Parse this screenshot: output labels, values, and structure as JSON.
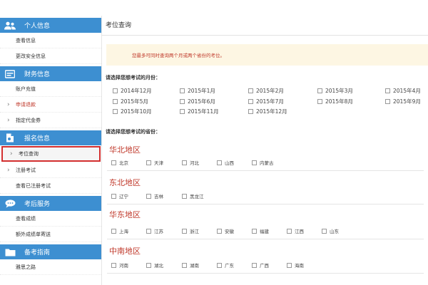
{
  "sidebar": {
    "sections": [
      {
        "title": "个人信息",
        "icon": "users-icon",
        "items": [
          {
            "label": "查看信息"
          },
          {
            "label": "更改安全信息"
          }
        ]
      },
      {
        "title": "财务信息",
        "icon": "finance-icon",
        "items": [
          {
            "label": "账户充值"
          },
          {
            "label": "申请退款"
          },
          {
            "label": "指定代金券"
          }
        ]
      },
      {
        "title": "报名信息",
        "icon": "document-icon",
        "items": [
          {
            "label": "考位查询"
          },
          {
            "label": "注册考试"
          },
          {
            "label": "查看已注册考试"
          }
        ]
      },
      {
        "title": "考后服务",
        "icon": "chat-icon",
        "items": [
          {
            "label": "查看成绩"
          },
          {
            "label": "额外成绩单寄送"
          }
        ]
      },
      {
        "title": "备考指南",
        "icon": "folder-icon",
        "items": [
          {
            "label": "雅思之路"
          }
        ]
      }
    ]
  },
  "main": {
    "title": "考位查询",
    "notice": "您最多可同时查询两个月或两个省份的考位。",
    "month_label": "请选择您想考试的月份：",
    "months": [
      "2014年12月",
      "2015年1月",
      "2015年2月",
      "2015年3月",
      "2015年4月",
      "2015年5月",
      "2015年6月",
      "2015年7月",
      "2015年8月",
      "2015年9月",
      "2015年10月",
      "2015年11月",
      "2015年12月"
    ],
    "province_label": "请选择您想考试的省份：",
    "regions": [
      {
        "name": "华北地区",
        "provinces": [
          "北京",
          "天津",
          "河北",
          "山西",
          "内蒙古"
        ]
      },
      {
        "name": "东北地区",
        "provinces": [
          "辽宁",
          "吉林",
          "黑龙江"
        ]
      },
      {
        "name": "华东地区",
        "provinces": [
          "上海",
          "江苏",
          "浙江",
          "安徽",
          "福建",
          "江西",
          "山东"
        ]
      },
      {
        "name": "中南地区",
        "provinces": [
          "河南",
          "湖北",
          "湖南",
          "广东",
          "广西",
          "海南"
        ]
      }
    ]
  }
}
